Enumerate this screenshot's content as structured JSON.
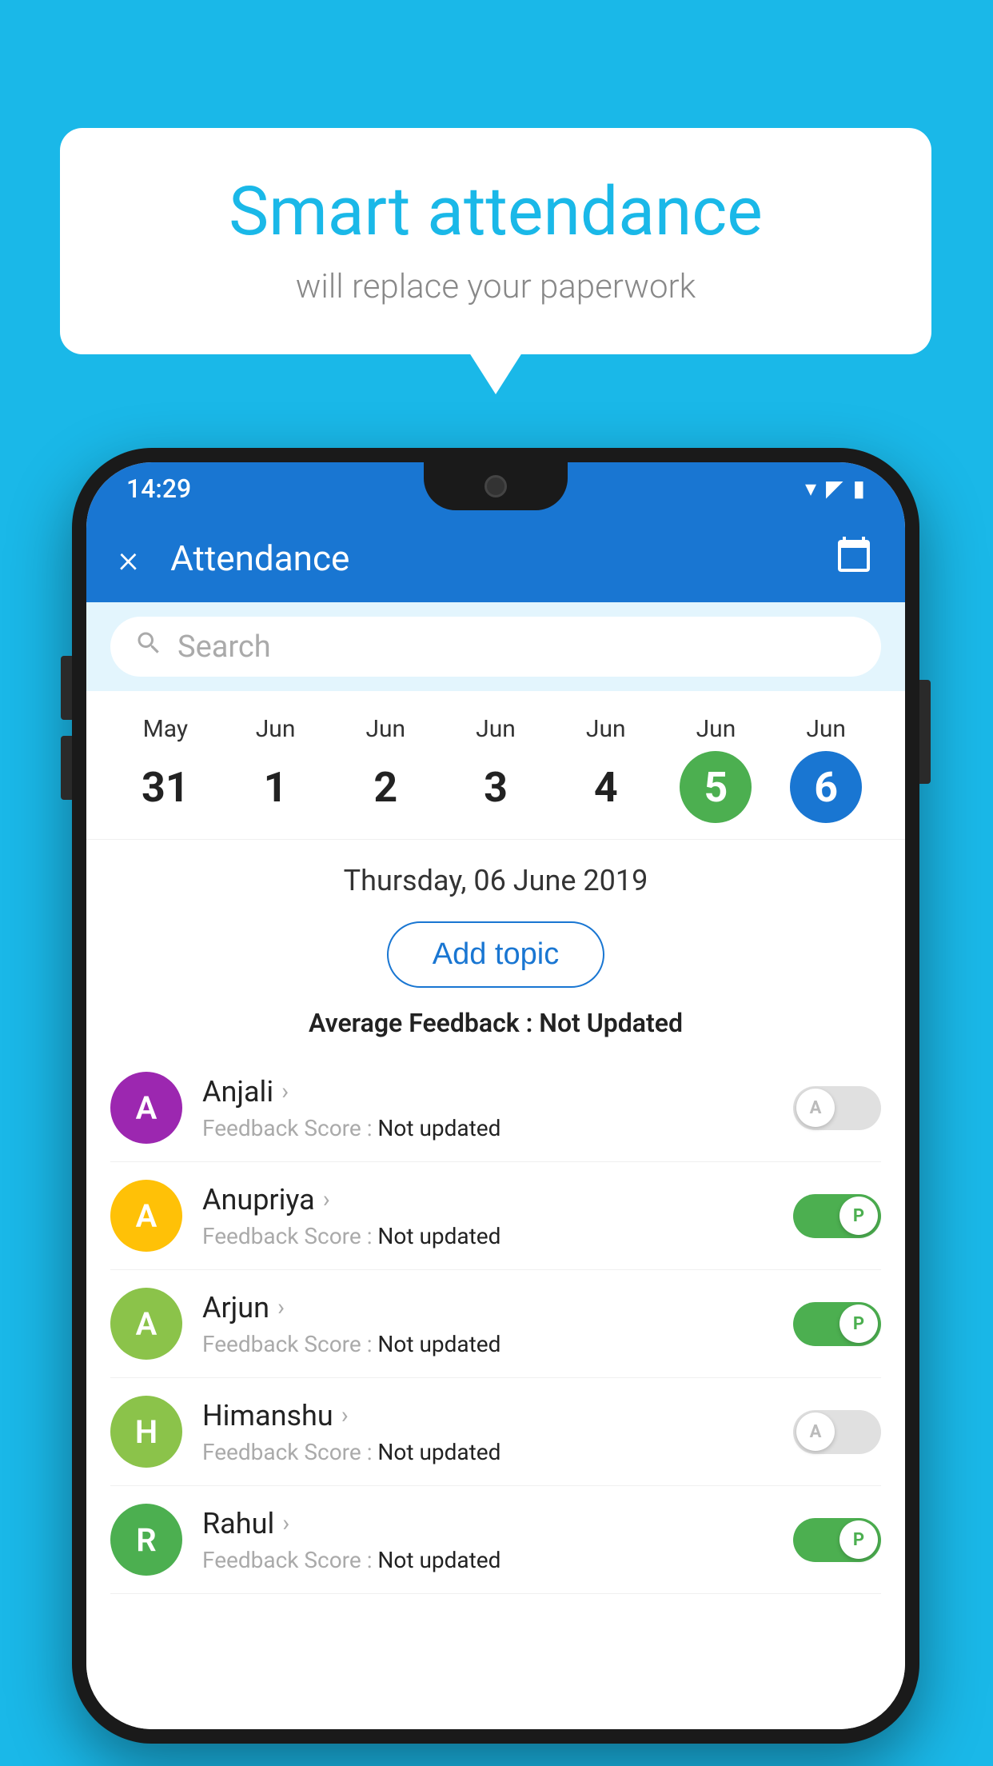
{
  "background_color": "#1ab8e8",
  "speech_bubble": {
    "title": "Smart attendance",
    "subtitle": "will replace your paperwork"
  },
  "status_bar": {
    "time": "14:29",
    "icons": [
      "wifi",
      "signal",
      "battery"
    ]
  },
  "app_bar": {
    "title": "Attendance",
    "close_label": "×",
    "calendar_icon": "📅"
  },
  "search": {
    "placeholder": "Search"
  },
  "dates": [
    {
      "month": "May",
      "day": "31",
      "style": "normal"
    },
    {
      "month": "Jun",
      "day": "1",
      "style": "normal"
    },
    {
      "month": "Jun",
      "day": "2",
      "style": "normal"
    },
    {
      "month": "Jun",
      "day": "3",
      "style": "normal"
    },
    {
      "month": "Jun",
      "day": "4",
      "style": "normal"
    },
    {
      "month": "Jun",
      "day": "5",
      "style": "today"
    },
    {
      "month": "Jun",
      "day": "6",
      "style": "selected"
    }
  ],
  "selected_date_label": "Thursday, 06 June 2019",
  "add_topic_label": "Add topic",
  "avg_feedback_label": "Average Feedback :",
  "avg_feedback_value": "Not Updated",
  "students": [
    {
      "name": "Anjali",
      "avatar_letter": "A",
      "avatar_color": "#9c27b0",
      "feedback_label": "Feedback Score :",
      "feedback_value": "Not updated",
      "attendance": "absent"
    },
    {
      "name": "Anupriya",
      "avatar_letter": "A",
      "avatar_color": "#ffc107",
      "feedback_label": "Feedback Score :",
      "feedback_value": "Not updated",
      "attendance": "present"
    },
    {
      "name": "Arjun",
      "avatar_letter": "A",
      "avatar_color": "#8bc34a",
      "feedback_label": "Feedback Score :",
      "feedback_value": "Not updated",
      "attendance": "present"
    },
    {
      "name": "Himanshu",
      "avatar_letter": "H",
      "avatar_color": "#8bc34a",
      "feedback_label": "Feedback Score :",
      "feedback_value": "Not updated",
      "attendance": "absent"
    },
    {
      "name": "Rahul",
      "avatar_letter": "R",
      "avatar_color": "#4caf50",
      "feedback_label": "Feedback Score :",
      "feedback_value": "Not updated",
      "attendance": "present"
    }
  ],
  "toggle_absent_letter": "A",
  "toggle_present_letter": "P"
}
